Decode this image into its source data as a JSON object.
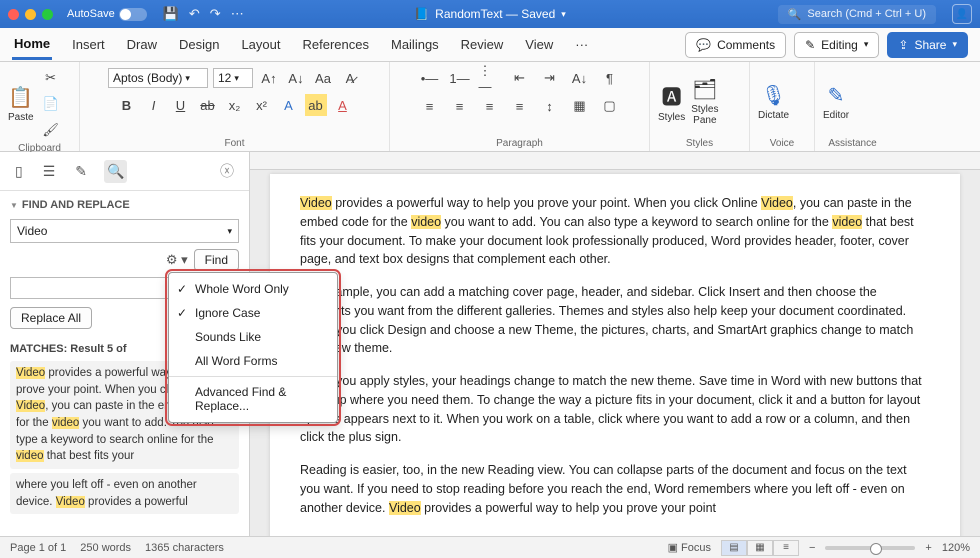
{
  "titlebar": {
    "autosave": "AutoSave",
    "doc_icon": "📄",
    "doc_name": "RandomText — Saved",
    "search": "Search (Cmd + Ctrl + U)"
  },
  "tabs": {
    "items": [
      "Home",
      "Insert",
      "Draw",
      "Design",
      "Layout",
      "References",
      "Mailings",
      "Review",
      "View"
    ],
    "more": "···",
    "comments": "Comments",
    "editing": "Editing",
    "share": "Share"
  },
  "ribbon": {
    "clipboard": "Clipboard",
    "paste": "Paste",
    "font_group": "Font",
    "font_name": "Aptos (Body)",
    "font_size": "12",
    "paragraph": "Paragraph",
    "styles": "Styles",
    "styles_btn": "Styles",
    "styles_pane": "Styles\nPane",
    "voice": "Voice",
    "dictate": "Dictate",
    "assistance": "Assistance",
    "editor": "Editor"
  },
  "sidepane": {
    "title": "FIND AND REPLACE",
    "search_value": "Video",
    "find_btn": "Find",
    "replace_all": "Replace All",
    "matches": "MATCHES: Result 5 of",
    "menu": {
      "whole_word": "Whole Word Only",
      "ignore_case": "Ignore Case",
      "sounds_like": "Sounds Like",
      "all_forms": "All Word Forms",
      "advanced": "Advanced Find & Replace..."
    },
    "results_html": "provides a powerful way to help you prove your point. When you click Online , you can paste in the embed code for the you want to add. You also type a keyword to search online for the that best fits your where you left off - even on another device. provides a powerful"
  },
  "document": {
    "p1a": "Video",
    "p1b": " provides a powerful way to help you prove your point. When you click Online ",
    "p1c": "Video",
    "p1d": ", you can paste in the embed code for the ",
    "p1e": "video",
    "p1f": " you want to add. You can also type a keyword to search online for the ",
    "p1g": "video",
    "p1h": " that best fits your document. To make your document look professionally produced, Word provides header, footer, cover page, and text box designs that complement each other.",
    "p2": "For example, you can add a matching cover page, header, and sidebar. Click Insert and then choose the elements you want from the different galleries. Themes and styles also help keep your document coordinated. When you click Design and choose a new Theme, the pictures, charts, and SmartArt graphics change to match your new theme.",
    "p3": "When you apply styles, your headings change to match the new theme. Save time in Word with new buttons that show up where you need them. To change the way a picture fits in your document, click it and a button for layout options appears next to it. When you work on a table, click where you want to add a row or a column, and then click the plus sign.",
    "p4a": "Reading is easier, too, in the new Reading view. You can collapse parts of the document and focus on the text you want. If you need to stop reading before you reach the end, Word remembers where you left off - even on another device. ",
    "p4b": "Video",
    "p4c": " provides a powerful way to help you prove your point"
  },
  "status": {
    "page": "Page 1 of 1",
    "words": "250 words",
    "chars": "1365 characters",
    "focus": "Focus",
    "zoom": "120%"
  }
}
